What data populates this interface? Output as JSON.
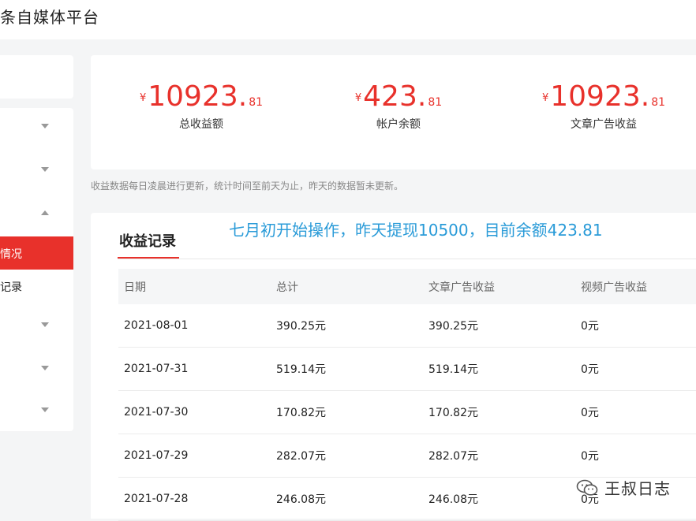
{
  "app": {
    "title": "条自媒体平台"
  },
  "sidebar": {
    "items": [
      {
        "label": ""
      },
      {
        "label": ""
      },
      {
        "label": ""
      },
      {
        "label": "情况"
      },
      {
        "label": "记录"
      },
      {
        "label": ""
      },
      {
        "label": ""
      },
      {
        "label": ""
      }
    ]
  },
  "summary": {
    "currency": "¥",
    "stats": [
      {
        "int": "10923",
        "dec": "81",
        "caption": "总收益额"
      },
      {
        "int": "423",
        "dec": "81",
        "caption": "帐户余额"
      },
      {
        "int": "10923",
        "dec": "81",
        "caption": "文章广告收益"
      }
    ]
  },
  "note": "收益数据每日凌晨进行更新，统计时间至前天为止，昨天的数据暂未更新。",
  "records": {
    "title": "收益记录",
    "annotation": "七月初开始操作，昨天提现10500，目前余额423.81",
    "columns": [
      "日期",
      "总计",
      "文章广告收益",
      "视频广告收益"
    ],
    "rows": [
      [
        "2021-08-01",
        "390.25元",
        "390.25元",
        "0元"
      ],
      [
        "2021-07-31",
        "519.14元",
        "519.14元",
        "0元"
      ],
      [
        "2021-07-30",
        "170.82元",
        "170.82元",
        "0元"
      ],
      [
        "2021-07-29",
        "282.07元",
        "282.07元",
        "0元"
      ],
      [
        "2021-07-28",
        "246.08元",
        "246.08元",
        "0元"
      ]
    ]
  },
  "watermark": {
    "text": "王叔日志",
    "icon": "wechat-icon"
  },
  "colors": {
    "accent": "#e8312b",
    "annotation": "#2a9bd8"
  }
}
